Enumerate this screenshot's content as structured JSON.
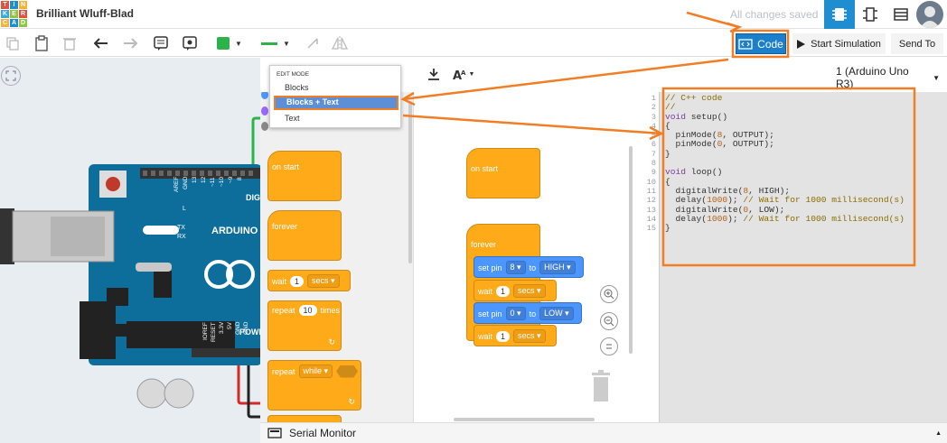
{
  "app": {
    "logo_letters": [
      "T",
      "I",
      "N",
      "K",
      "E",
      "R",
      "C",
      "A",
      "D"
    ],
    "logo_colors": [
      "#e2513e",
      "#1f8ed0",
      "#f0b43b",
      "#3da6de",
      "#8fc63f",
      "#e2513e",
      "#f0b43b",
      "#1f8ed0",
      "#8fc63f"
    ],
    "project_title": "Brilliant Wluff-Blad",
    "save_status": "All changes saved"
  },
  "toolbar": {
    "code_label": "Code",
    "start_sim_label": "Start Simulation",
    "send_to_label": "Send To",
    "fill_color": "#2db34a",
    "line_color": "#2db34a"
  },
  "edit_mode_menu": {
    "header": "EDIT MODE",
    "items": [
      "Blocks",
      "Blocks + Text",
      "Text"
    ],
    "selected": "Blocks + Text"
  },
  "board_select": {
    "value": "1 (Arduino Uno R3)"
  },
  "palette": {
    "on_start": "on start",
    "forever": "forever",
    "wait": "wait",
    "wait_value": "1",
    "wait_unit": "secs",
    "repeat": "repeat",
    "repeat_value": "10",
    "repeat_suffix": "times",
    "repeat_while": "repeat",
    "while_option": "while"
  },
  "workspace": {
    "on_start": "on start",
    "forever": "forever",
    "set_pin_1": {
      "label": "set pin",
      "pin": "8",
      "to": "to",
      "value": "HIGH"
    },
    "wait_1": {
      "label": "wait",
      "value": "1",
      "unit": "secs"
    },
    "set_pin_2": {
      "label": "set pin",
      "pin": "0",
      "to": "to",
      "value": "LOW"
    },
    "wait_2": {
      "label": "wait",
      "value": "1",
      "unit": "secs"
    }
  },
  "code": {
    "line_numbers": [
      "1",
      "2",
      "3",
      "4",
      "5",
      "6",
      "7",
      "8",
      "9",
      "10",
      "11",
      "12",
      "13",
      "14",
      "15"
    ],
    "lines": [
      "// C++ code",
      "//",
      "void setup()",
      "{",
      "  pinMode(8, OUTPUT);",
      "  pinMode(0, OUTPUT);",
      "}",
      "",
      "void loop()",
      "{",
      "  digitalWrite(8, HIGH);",
      "  delay(1000); // Wait for 1000 millisecond(s)",
      "  digitalWrite(0, LOW);",
      "  delay(1000); // Wait for 1000 millisecond(s)",
      "}"
    ]
  },
  "serial_monitor": {
    "label": "Serial Monitor"
  },
  "board": {
    "brand": "ARDUINO",
    "digital_header": "DIG",
    "power_header": "POWE",
    "pin_labels": [
      "AREF",
      "GND",
      "13",
      "12",
      "~11",
      "~10",
      "~9",
      "8"
    ],
    "power_pin_labels": [
      "IOREF",
      "RESET",
      "3.3V",
      "5V",
      "GND",
      "GND"
    ],
    "tx_label": "TX",
    "rx_label": "RX",
    "l_label": "L"
  },
  "annotation_color": "#f17d25"
}
